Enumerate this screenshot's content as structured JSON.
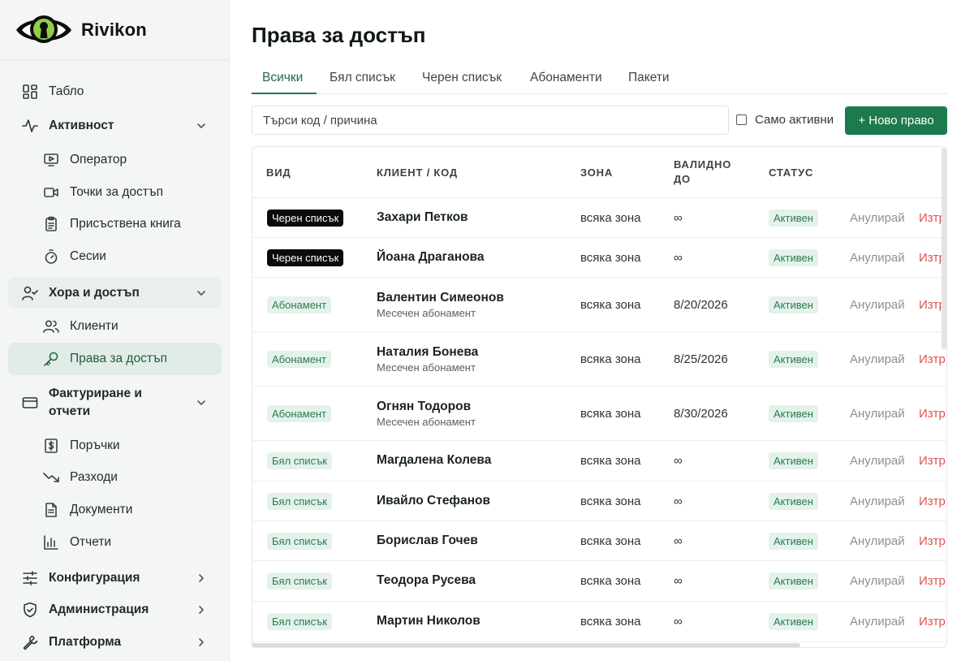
{
  "brand": {
    "name": "Rivikon"
  },
  "sidebar": {
    "items": [
      {
        "label": "Табло",
        "icon": "dashboard-icon"
      },
      {
        "label": "Активност",
        "icon": "activity-icon"
      },
      {
        "label": "Оператор",
        "icon": "monitor-icon"
      },
      {
        "label": "Точки за достъп",
        "icon": "camera-icon"
      },
      {
        "label": "Присъствена книга",
        "icon": "clipboard-icon"
      },
      {
        "label": "Сесии",
        "icon": "stopwatch-icon"
      },
      {
        "label": "Хора и достъп",
        "icon": "user-check-icon"
      },
      {
        "label": "Клиенти",
        "icon": "users-icon"
      },
      {
        "label": "Права за достъп",
        "icon": "key-icon"
      },
      {
        "label": "Фактуриране и отчети",
        "icon": "credit-card-icon"
      },
      {
        "label": "Поръчки",
        "icon": "dollar-receipt-icon"
      },
      {
        "label": "Разходи",
        "icon": "trending-down-icon"
      },
      {
        "label": "Документи",
        "icon": "document-icon"
      },
      {
        "label": "Отчети",
        "icon": "bar-chart-icon"
      },
      {
        "label": "Конфигурация",
        "icon": "sliders-icon"
      },
      {
        "label": "Администрация",
        "icon": "shield-icon"
      },
      {
        "label": "Платформа",
        "icon": "wrench-icon"
      }
    ]
  },
  "main": {
    "title": "Права за достъп",
    "tabs": [
      {
        "label": "Всички"
      },
      {
        "label": "Бял списък"
      },
      {
        "label": "Черен списък"
      },
      {
        "label": "Абонаменти"
      },
      {
        "label": "Пакети"
      }
    ],
    "search_placeholder": "Търси код / причина",
    "only_active_label": "Само активни",
    "new_button_label": "+ Ново право",
    "columns": {
      "kind": "ВИД",
      "client": "КЛИЕНТ / КОД",
      "zone": "ЗОНА",
      "valid_until_line1": "ВАЛИДНО",
      "valid_until_line2": "ДО",
      "status": "СТАТУС"
    },
    "rows": [
      {
        "kind": "Черен списък",
        "kind_style": "black",
        "name": "Захари Петков",
        "sub": "",
        "zone": "всяка зона",
        "valid": "∞",
        "status": "Активен",
        "revoke": "Анулирай",
        "delete": "Изтр"
      },
      {
        "kind": "Черен списък",
        "kind_style": "black",
        "name": "Йоана Драганова",
        "sub": "",
        "zone": "всяка зона",
        "valid": "∞",
        "status": "Активен",
        "revoke": "Анулирай",
        "delete": "Изтр"
      },
      {
        "kind": "Абонамент",
        "kind_style": "green",
        "name": "Валентин Симеонов",
        "sub": "Месечен абонамент",
        "zone": "всяка зона",
        "valid": "8/20/2026",
        "status": "Активен",
        "revoke": "Анулирай",
        "delete": "Изтр"
      },
      {
        "kind": "Абонамент",
        "kind_style": "green",
        "name": "Наталия Бонева",
        "sub": "Месечен абонамент",
        "zone": "всяка зона",
        "valid": "8/25/2026",
        "status": "Активен",
        "revoke": "Анулирай",
        "delete": "Изтр"
      },
      {
        "kind": "Абонамент",
        "kind_style": "green",
        "name": "Огнян Тодоров",
        "sub": "Месечен абонамент",
        "zone": "всяка зона",
        "valid": "8/30/2026",
        "status": "Активен",
        "revoke": "Анулирай",
        "delete": "Изтр"
      },
      {
        "kind": "Бял списък",
        "kind_style": "green",
        "name": "Магдалена Колева",
        "sub": "",
        "zone": "всяка зона",
        "valid": "∞",
        "status": "Активен",
        "revoke": "Анулирай",
        "delete": "Изтр"
      },
      {
        "kind": "Бял списък",
        "kind_style": "green",
        "name": "Ивайло Стефанов",
        "sub": "",
        "zone": "всяка зона",
        "valid": "∞",
        "status": "Активен",
        "revoke": "Анулирай",
        "delete": "Изтр"
      },
      {
        "kind": "Бял списък",
        "kind_style": "green",
        "name": "Борислав Гочев",
        "sub": "",
        "zone": "всяка зона",
        "valid": "∞",
        "status": "Активен",
        "revoke": "Анулирай",
        "delete": "Изтр"
      },
      {
        "kind": "Бял списък",
        "kind_style": "green",
        "name": "Теодора Русева",
        "sub": "",
        "zone": "всяка зона",
        "valid": "∞",
        "status": "Активен",
        "revoke": "Анулирай",
        "delete": "Изтр"
      },
      {
        "kind": "Бял списък",
        "kind_style": "green",
        "name": "Мартин Николов",
        "sub": "",
        "zone": "всяка зона",
        "valid": "∞",
        "status": "Активен",
        "revoke": "Анулирай",
        "delete": "Изтр"
      }
    ]
  },
  "colors": {
    "accent": "#1d7a4c",
    "active_nav_bg": "#e2ece7",
    "danger": "#e05252",
    "status_bg": "#e3f2ea"
  }
}
